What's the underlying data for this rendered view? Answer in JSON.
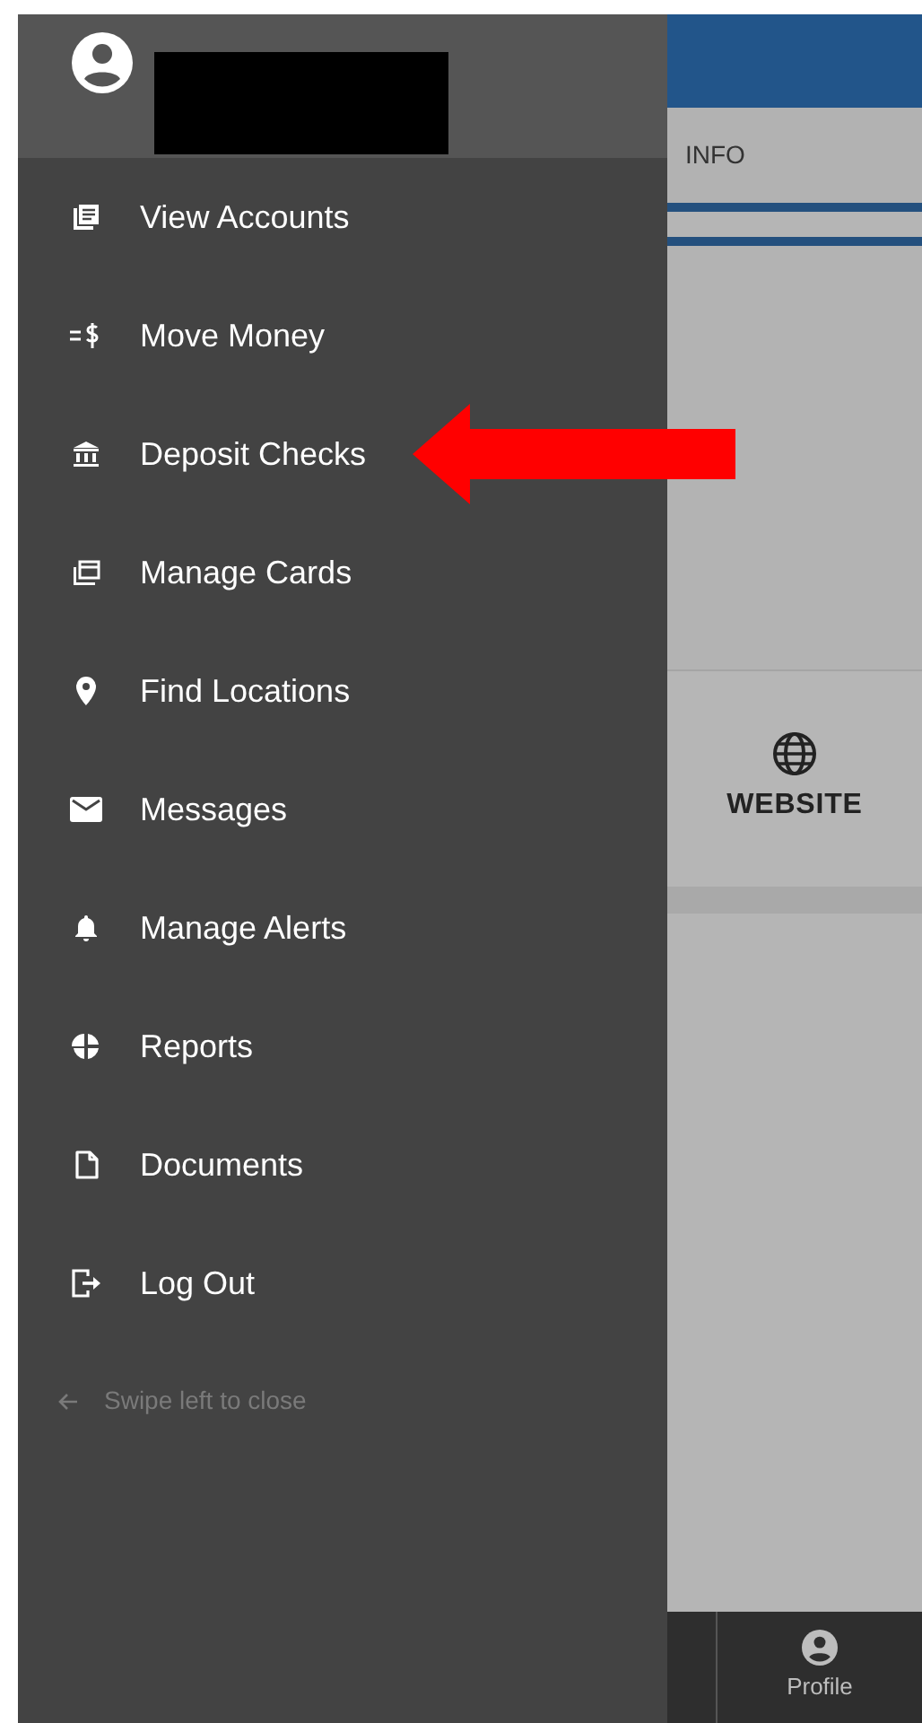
{
  "drawer": {
    "items": [
      {
        "label": "View Accounts",
        "kind": "accounts",
        "arrow": false
      },
      {
        "label": "Move Money",
        "kind": "transfer",
        "arrow": false
      },
      {
        "label": "Deposit Checks",
        "kind": "bank",
        "arrow": true
      },
      {
        "label": "Manage Cards",
        "kind": "cards",
        "arrow": false
      },
      {
        "label": "Find Locations",
        "kind": "pin",
        "arrow": false
      },
      {
        "label": "Messages",
        "kind": "mail",
        "arrow": false
      },
      {
        "label": "Manage Alerts",
        "kind": "bell",
        "arrow": false
      },
      {
        "label": "Reports",
        "kind": "pie",
        "arrow": false
      },
      {
        "label": "Documents",
        "kind": "doc",
        "arrow": false
      },
      {
        "label": "Log Out",
        "kind": "logout",
        "arrow": false
      }
    ],
    "hint": "Swipe left to close"
  },
  "background": {
    "tab": "INFO",
    "card_button": "WEBSITE",
    "bottom_nav": [
      {
        "label": "Profile"
      }
    ]
  }
}
